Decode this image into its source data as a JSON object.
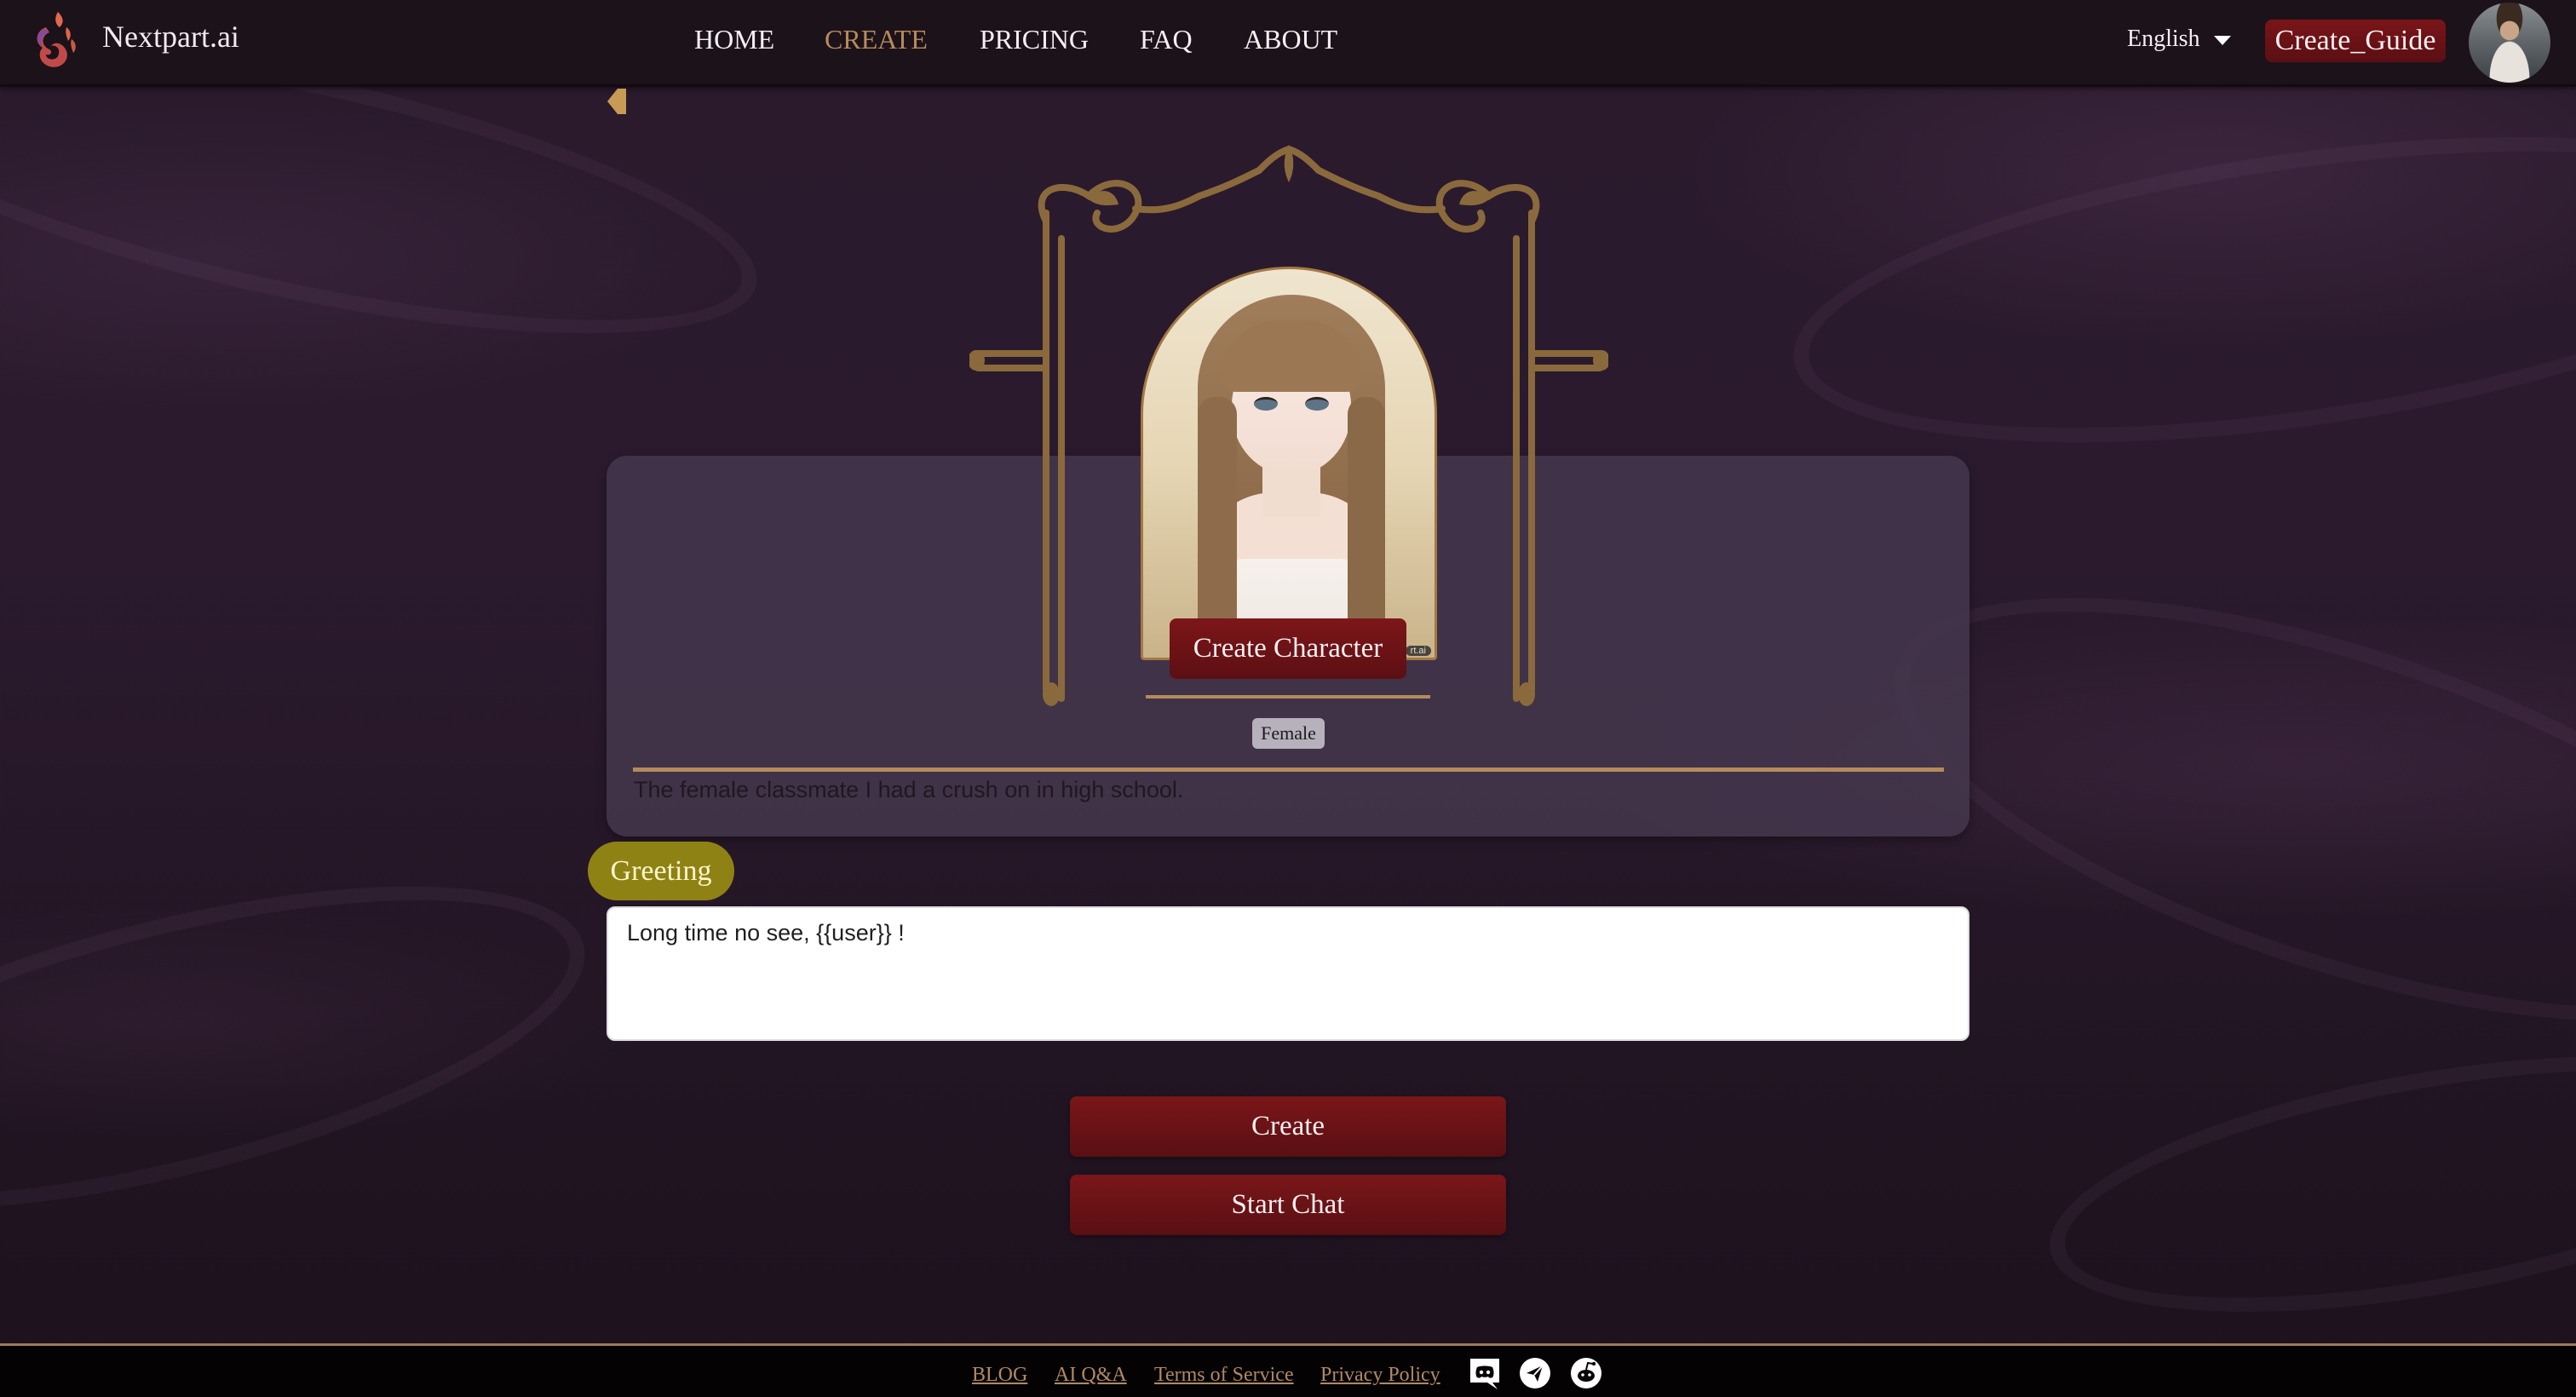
{
  "header": {
    "brand": "Nextpart.ai",
    "nav": [
      {
        "label": "HOME",
        "active": false
      },
      {
        "label": "CREATE",
        "active": true
      },
      {
        "label": "PRICING",
        "active": false
      },
      {
        "label": "FAQ",
        "active": false
      },
      {
        "label": "ABOUT",
        "active": false
      }
    ],
    "language": "English",
    "guide_button": "Create_Guide",
    "accent_color": "#b58a5c"
  },
  "character": {
    "create_character_label": "Create Character",
    "gender": "Female",
    "description": "The female classmate I had a crush on in high school.",
    "watermark": "rt.ai"
  },
  "greeting": {
    "label": "Greeting",
    "value": "Long time no see, {{user}} !"
  },
  "actions": {
    "create": "Create",
    "start_chat": "Start Chat"
  },
  "footer": {
    "links": [
      "BLOG",
      "AI Q&A",
      "Terms of Service",
      "Privacy Policy"
    ],
    "socials": [
      "discord-icon",
      "telegram-icon",
      "reddit-icon"
    ]
  }
}
